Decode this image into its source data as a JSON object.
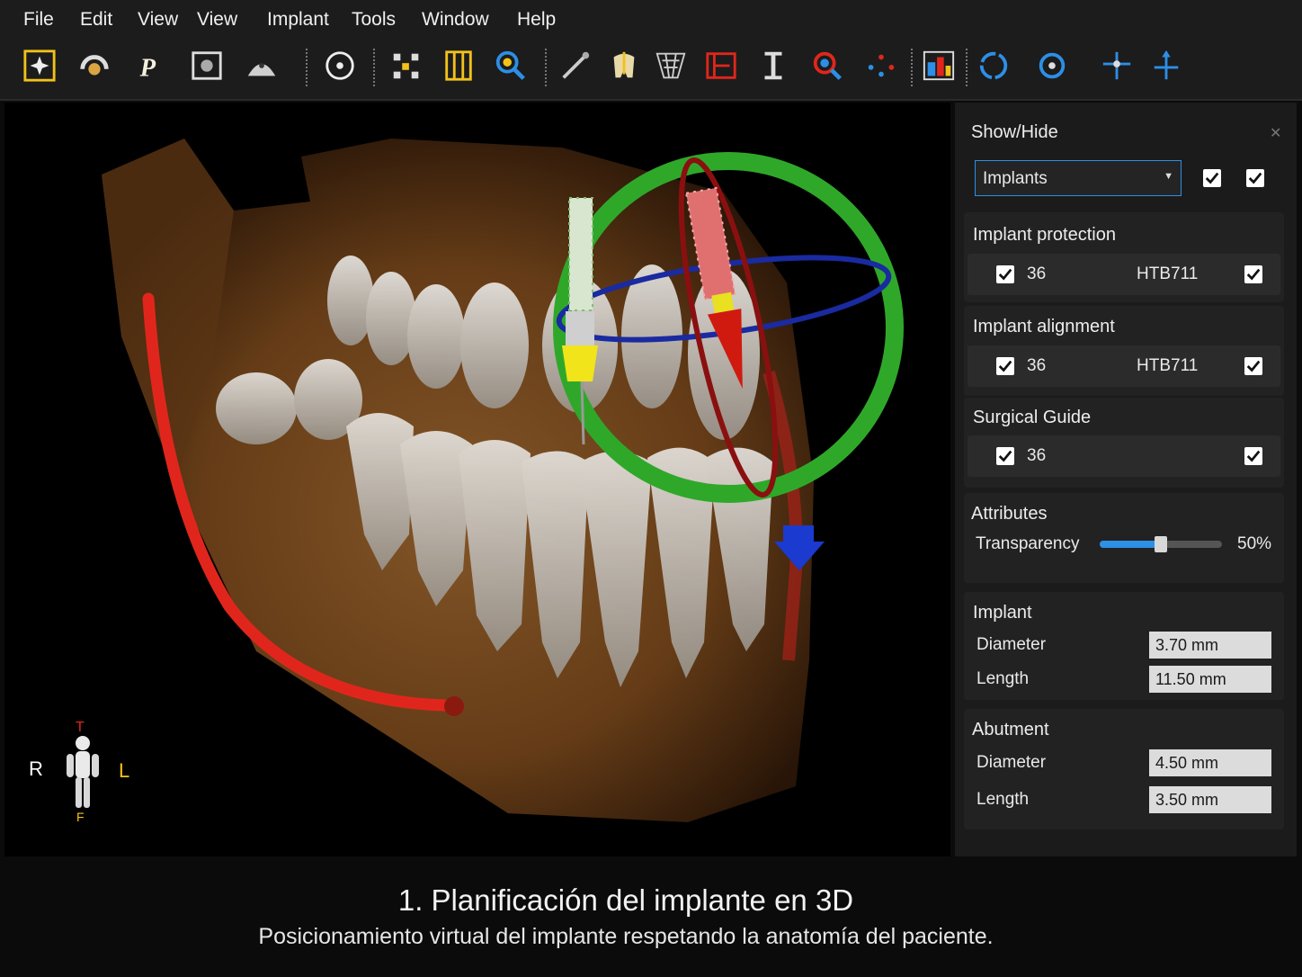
{
  "menu": [
    "File",
    "Edit",
    "View",
    "View",
    "Implant",
    "Tools",
    "Window",
    "Help"
  ],
  "toolbar_icons": [
    "volume-render-icon",
    "panorama-icon",
    "patient-icon",
    "image-frame-icon",
    "dome-icon",
    "crosshair-circle-icon",
    "nerve-points-icon",
    "grid-ruler-icon",
    "zoom-icon",
    "scalpel-icon",
    "tooth-icon",
    "mesh-icon",
    "measure-angle-icon",
    "caliper-icon",
    "magnify-red-icon",
    "dots-icon",
    "layout-icon",
    "rotate-icon",
    "recenter-icon",
    "axis-move-icon",
    "axis-icon"
  ],
  "viewport": {
    "orientation": {
      "right": "R",
      "left": "L",
      "top": "T",
      "foot": "F"
    }
  },
  "panel": {
    "show_hide": {
      "title": "Show/Hide",
      "dropdown_value": "Implants",
      "checked_1": true,
      "checked_2": true
    },
    "implant_protection": {
      "title": "Implant protection",
      "tooth": "36",
      "model": "HTB711"
    },
    "implant_alignment": {
      "title": "Implant alignment",
      "tooth": "36",
      "model": "HTB711"
    },
    "surgical_guide": {
      "title": "Surgical Guide",
      "tooth": "36"
    },
    "attributes": {
      "title": "Attributes",
      "transparency_label": "Transparency",
      "transparency_value": "50%",
      "transparency_fraction": 0.5
    },
    "implant": {
      "title": "Implant",
      "diameter_label": "Diameter",
      "diameter": "3.70 mm",
      "length_label": "Length",
      "length": "11.50 mm"
    },
    "abutment": {
      "title": "Abutment",
      "diameter_label": "Diameter",
      "diameter": "4.50 mm",
      "length_label": "Length",
      "length": "3.50 mm"
    }
  },
  "caption": {
    "title": "1. Planificación del implante en 3D",
    "subtitle": "Posicionamiento virtual del implante respetando la anatomía del paciente."
  },
  "colors": {
    "accent_yellow": "#f2c21a",
    "accent_blue": "#2d8fe6",
    "ring_green": "#2fa82a",
    "nerve_red": "#e0261c"
  }
}
